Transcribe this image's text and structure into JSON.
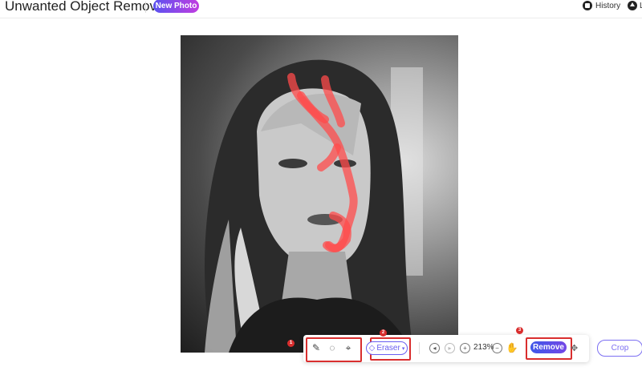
{
  "header": {
    "app_title": "Unwanted Object Remover",
    "new_photo_label": "New Photo",
    "history_label": "History",
    "user_label": "L"
  },
  "toolbar": {
    "tools": [
      "brush-icon",
      "lasso-icon",
      "polygon-lasso-icon"
    ],
    "eraser_label": "Eraser",
    "zoom_level": "213%",
    "remove_label": "Remove",
    "step_badges": [
      "1",
      "2",
      "3"
    ]
  },
  "crop_label": "Crop",
  "colors": {
    "accent": "#6a5ef0",
    "highlight": "#d92e2e",
    "mask": "#ff4b4b"
  }
}
